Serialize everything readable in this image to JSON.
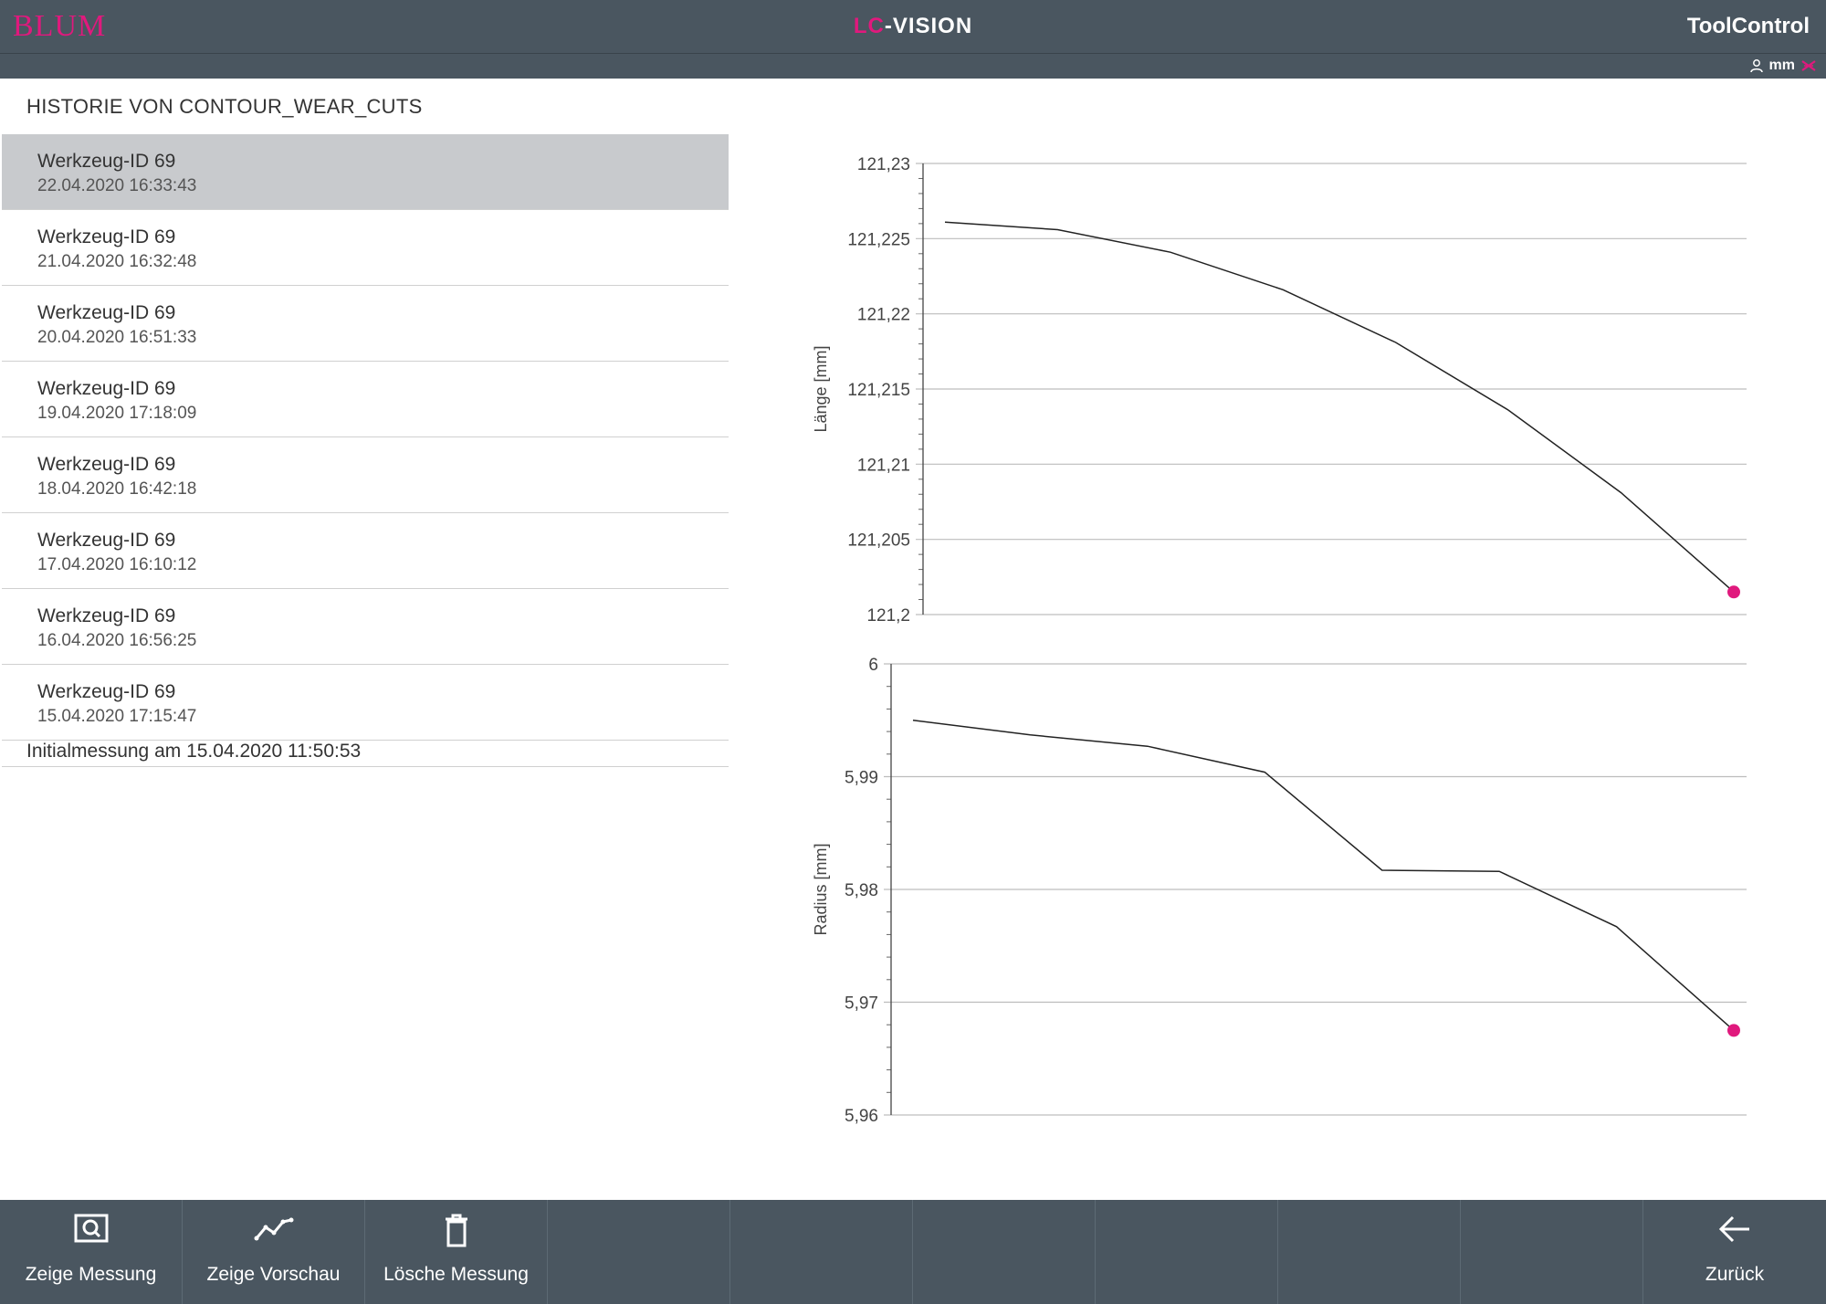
{
  "header": {
    "logo": "BLUM",
    "title_prefix": "LC",
    "title_suffix": "-VISION",
    "brand": "ToolControl"
  },
  "subbar": {
    "unit": "mm",
    "user_icon": "user-icon",
    "unit_toggle_icon": "unit-toggle-icon"
  },
  "history": {
    "title": "HISTORIE VON CONTOUR_WEAR_CUTS",
    "items": [
      {
        "name": "Werkzeug-ID 69",
        "date": "22.04.2020 16:33:43",
        "selected": true
      },
      {
        "name": "Werkzeug-ID 69",
        "date": "21.04.2020 16:32:48",
        "selected": false
      },
      {
        "name": "Werkzeug-ID 69",
        "date": "20.04.2020 16:51:33",
        "selected": false
      },
      {
        "name": "Werkzeug-ID 69",
        "date": "19.04.2020 17:18:09",
        "selected": false
      },
      {
        "name": "Werkzeug-ID 69",
        "date": "18.04.2020 16:42:18",
        "selected": false
      },
      {
        "name": "Werkzeug-ID 69",
        "date": "17.04.2020 16:10:12",
        "selected": false
      },
      {
        "name": "Werkzeug-ID 69",
        "date": "16.04.2020 16:56:25",
        "selected": false
      },
      {
        "name": "Werkzeug-ID 69",
        "date": "15.04.2020 17:15:47",
        "selected": false
      }
    ],
    "initial": "Initialmessung am 15.04.2020 11:50:53"
  },
  "chart_data": [
    {
      "type": "line",
      "ylabel": "Länge [mm]",
      "ylim": [
        121.2,
        121.23
      ],
      "yticks": [
        121.23,
        121.225,
        121.22,
        121.215,
        121.21,
        121.205,
        121.2
      ],
      "ytick_labels": [
        "121,23",
        "121,225",
        "121,22",
        "121,215",
        "121,21",
        "121,205",
        "121,2"
      ],
      "grid": true,
      "x": [
        1,
        2,
        3,
        4,
        5,
        6,
        7,
        8
      ],
      "values": [
        121.2261,
        121.2256,
        121.2241,
        121.2216,
        121.2181,
        121.2136,
        121.2081,
        121.2015
      ],
      "highlight_last": true,
      "line_color": "#222222",
      "marker_color": "#e0197d"
    },
    {
      "type": "line",
      "ylabel": "Radius [mm]",
      "ylim": [
        5.96,
        6.0
      ],
      "yticks": [
        6.0,
        5.99,
        5.98,
        5.97,
        5.96
      ],
      "ytick_labels": [
        "6",
        "5,99",
        "5,98",
        "5,97",
        "5,96"
      ],
      "grid": true,
      "x": [
        1,
        2,
        3,
        4,
        5,
        6,
        7,
        8
      ],
      "values": [
        5.995,
        5.9937,
        5.9927,
        5.9904,
        5.9817,
        5.9816,
        5.9767,
        5.9675
      ],
      "highlight_last": true,
      "line_color": "#222222",
      "marker_color": "#e0197d"
    }
  ],
  "toolbar": {
    "buttons": [
      {
        "label": "Zeige Messung",
        "icon": "search-icon"
      },
      {
        "label": "Zeige Vorschau",
        "icon": "chart-line-icon"
      },
      {
        "label": "Lösche Messung",
        "icon": "trash-icon"
      },
      {
        "label": "",
        "icon": ""
      },
      {
        "label": "",
        "icon": ""
      },
      {
        "label": "",
        "icon": ""
      },
      {
        "label": "",
        "icon": ""
      },
      {
        "label": "",
        "icon": ""
      },
      {
        "label": "",
        "icon": ""
      },
      {
        "label": "Zurück",
        "icon": "arrow-left-icon"
      }
    ]
  },
  "colors": {
    "header_bg": "#4a5660",
    "accent": "#e0197d",
    "selected_row": "#c8cacd"
  }
}
